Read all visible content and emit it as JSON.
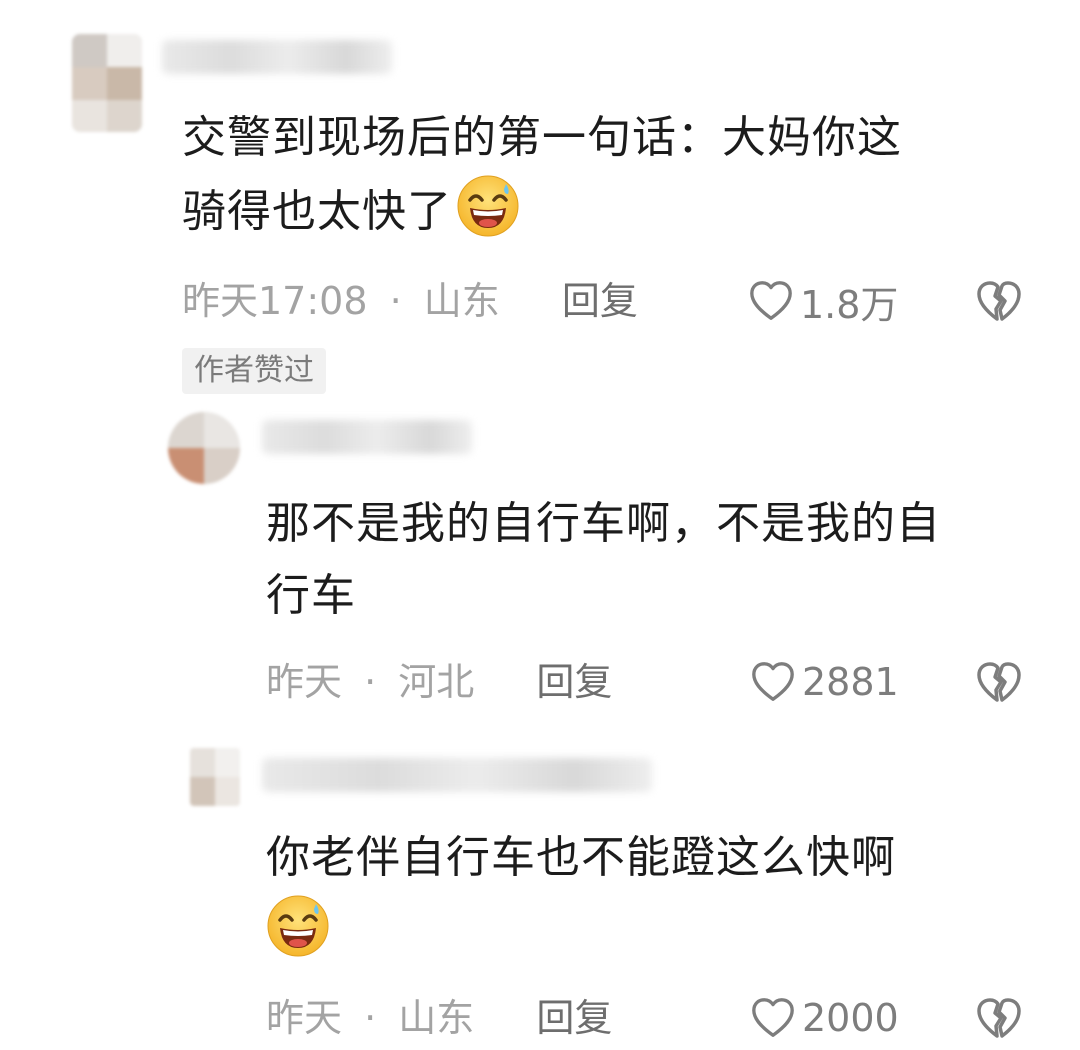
{
  "comments": [
    {
      "text": "交警到现场后的第一句话：大妈你这",
      "text2": "骑得也太快了",
      "emoji": "grinning-sweat-face",
      "time": "昨天17:08",
      "sep": "·",
      "location": "山东",
      "reply_label": "回复",
      "likes": "1.8万",
      "author_tag": "作者赞过"
    },
    {
      "text": "那不是我的自行车啊，不是我的自",
      "text2": "行车",
      "time": "昨天",
      "sep": "·",
      "location": "河北",
      "reply_label": "回复",
      "likes": "2881"
    },
    {
      "text": "你老伴自行车也不能蹬这么快啊",
      "emoji": "grinning-sweat-face",
      "time": "昨天",
      "sep": "·",
      "location": "山东",
      "reply_label": "回复",
      "likes": "2000"
    }
  ],
  "colors": {
    "text": "#1c1c1c",
    "meta": "#a3a3a3",
    "reply": "#6e6e6e",
    "tag_bg": "#f1f1f1"
  }
}
